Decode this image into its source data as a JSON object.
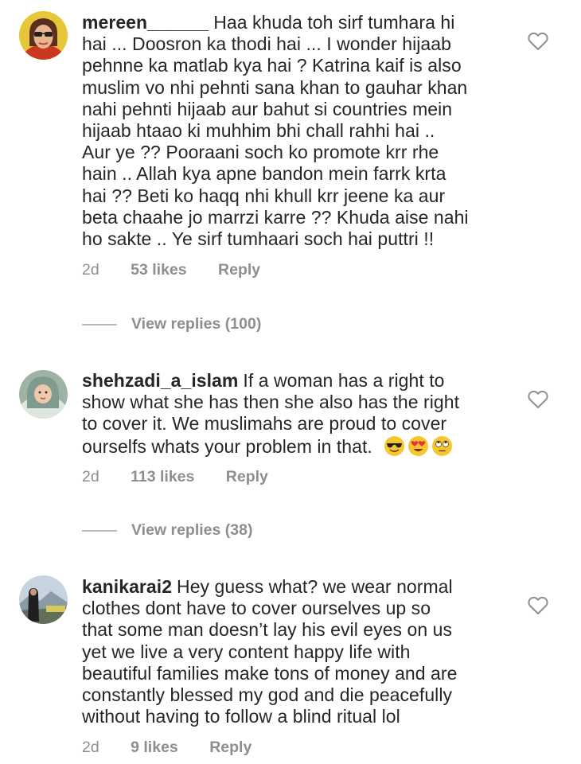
{
  "comments": [
    {
      "username": "mereen______",
      "lines": [
        "Haa khuda toh sirf tumhara hi",
        "hai ... Doosron ka thodi hai ... I wonder hijaab",
        "pehnne ka matlab kya hai ? Katrina kaif is also",
        "muslim vo nhi pehnti sana khan to gauhar khan",
        "nahi pehnti hijaab aur bahut si countries mein",
        "hijaab htaao ki muhhim bhi chall rahhi hai ..",
        "Aur ye ?? Pooraani soch ko promote krr rhe",
        "hain .. Allah kya apne bandon mein farrk krta",
        "hai ?? Beti ko haqq nhi khull krr jeene ka aur",
        "beta chaahe jo marrzi karre ?? Khuda aise nahi",
        "ho sakte .. Ye sirf tumhaari soch hai puttri !!"
      ],
      "time": "2d",
      "likes": "53 likes",
      "reply": "Reply",
      "view_replies": "View replies (100)",
      "avatar_icon": "profile-photo-woman-sunglasses"
    },
    {
      "username": "shehzadi_a_islam",
      "lines": [
        "If a woman has a right to",
        "show what she has then she also has the right",
        "to cover it. We muslimahs are proud to cover",
        "ourselfs whats your problem in that."
      ],
      "emojis": [
        "smiling-face-with-sunglasses",
        "smiling-face-with-heart-eyes",
        "face-with-rolling-eyes"
      ],
      "time": "2d",
      "likes": "113 likes",
      "reply": "Reply",
      "view_replies": "View replies (38)",
      "avatar_icon": "profile-photo-baby-in-blanket"
    },
    {
      "username": "kanikarai2",
      "lines": [
        "Hey guess what? we wear normal",
        "clothes dont have to cover ourselves up so",
        "that some man doesn’t lay his evil eyes on us",
        "yet we live a very content happy life with",
        "beautiful families make tons of money and are",
        "constantly blessed my god and die peacefully",
        "without having to follow a blind ritual lol"
      ],
      "time": "2d",
      "likes": "9 likes",
      "reply": "Reply",
      "avatar_icon": "profile-photo-mountain-view"
    }
  ],
  "colors": {
    "text": "#262626",
    "meta": "#8e8e8e",
    "divider": "#b8b8b8"
  },
  "icons": {
    "like": "heart-outline-icon"
  }
}
